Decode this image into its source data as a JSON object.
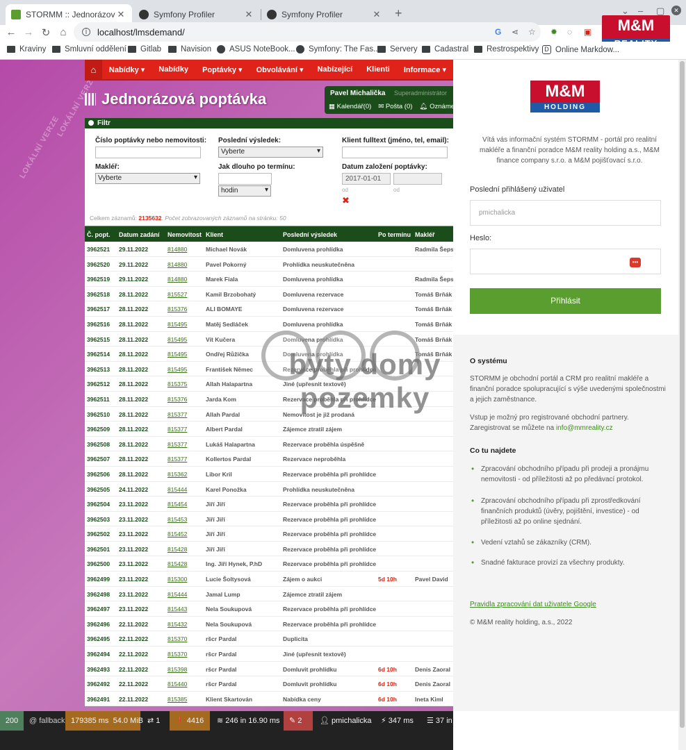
{
  "browser": {
    "tabs": [
      {
        "title": "STORMM :: Jednorázová popt",
        "active": true
      },
      {
        "title": "Symfony Profiler",
        "active": false
      },
      {
        "title": "Symfony Profiler",
        "active": false
      }
    ],
    "url": "localhost/lmsdemand/",
    "bookmarks": [
      "Kraviny",
      "Smluvní oddělení",
      "Gitlab",
      "Navision",
      "ASUS NoteBook...",
      "Symfony: The Fas...",
      "Servery",
      "Cadastral",
      "Restrospektivy",
      "Online Markdow..."
    ],
    "logo_top": "M&M",
    "logo_top_sub": "REALITY"
  },
  "nav": {
    "items": [
      "Nabídky ▾",
      "Nabídky",
      "Poptávky ▾",
      "Obvolávání ▾",
      "Nabízející",
      "Klienti",
      "Informace ▾"
    ]
  },
  "page": {
    "title": "Jednorázová poptávka",
    "watermark_side": "LOKÁLNÍ VERZE",
    "watermark_main": "byty domy pozemky"
  },
  "user": {
    "name": "Pavel Michalička",
    "role": "Superadministrátor",
    "calendar": "Kalendář(0)",
    "mail": "Pošta (0)",
    "notices": "Oznámení"
  },
  "filter": {
    "header": "Filtr",
    "f1_label": "Číslo poptávky nebo nemovitosti:",
    "f2_label": "Poslední výsledek:",
    "f2_value": "Vyberte",
    "f3_label": "Klient fulltext (jméno, tel, email):",
    "f4_label": "Makléř:",
    "f4_value": "Vyberte",
    "f5_label": "Jak dlouho po termínu:",
    "f5_unit": "hodin",
    "f6_label": "Datum založení poptávky:",
    "f6_from": "2017-01-01",
    "od1": "od",
    "od2": "od"
  },
  "counts": {
    "prefix": "Celkem záznamů:",
    "total": "2135632",
    "perpage": "Počet zobrazovaných záznamů na stránku: 50"
  },
  "table": {
    "headers": [
      "Č. popt.",
      "Datum zadání",
      "Nemovitost",
      "Klient",
      "Poslední výsledek",
      "Po termínu",
      "Makléř"
    ],
    "rows": [
      [
        "3962521",
        "29.11.2022",
        "814880",
        "Michael Novák",
        "Domluvena prohlídka",
        "",
        "Radmila Šeps"
      ],
      [
        "3962520",
        "29.11.2022",
        "814880",
        "Pavel Pokorný",
        "Prohlídka neuskutečněna",
        "",
        ""
      ],
      [
        "3962519",
        "29.11.2022",
        "814880",
        "Marek Fiala",
        "Domluvena prohlídka",
        "",
        "Radmila Šeps"
      ],
      [
        "3962518",
        "28.11.2022",
        "815527",
        "Kamil Brzobohatý",
        "Domluvena rezervace",
        "",
        "Tomáš Brňák"
      ],
      [
        "3962517",
        "28.11.2022",
        "815376",
        "ALI BOMAYE",
        "Domluvena rezervace",
        "",
        "Tomáš Brňák"
      ],
      [
        "3962516",
        "28.11.2022",
        "815495",
        "Matěj Sedláček",
        "Domluvena prohlídka",
        "",
        "Tomáš Brňák"
      ],
      [
        "3962515",
        "28.11.2022",
        "815495",
        "Vít Kučera",
        "Domluvena prohlídka",
        "",
        "Tomáš Brňák"
      ],
      [
        "3962514",
        "28.11.2022",
        "815495",
        "Ondřej Růžička",
        "Domluvena prohlídka",
        "",
        "Tomáš Brňák"
      ],
      [
        "3962513",
        "28.11.2022",
        "815495",
        "František Němec",
        "Rezervace proběhla při prohlídce",
        "",
        ""
      ],
      [
        "3962512",
        "28.11.2022",
        "815375",
        "Allah Halapartna",
        "Jiné (upřesnit textově)",
        "",
        ""
      ],
      [
        "3962511",
        "28.11.2022",
        "815376",
        "Jarda Kom",
        "Rezervace proběhla při prohlídce",
        "",
        ""
      ],
      [
        "3962510",
        "28.11.2022",
        "815377",
        "Allah Pardal",
        "Nemovitost je již prodaná",
        "",
        ""
      ],
      [
        "3962509",
        "28.11.2022",
        "815377",
        "Albert Pardal",
        "Zájemce ztratil zájem",
        "",
        ""
      ],
      [
        "3962508",
        "28.11.2022",
        "815377",
        "Lukáš Halapartna",
        "Rezervace proběhla úspěšně",
        "",
        ""
      ],
      [
        "3962507",
        "28.11.2022",
        "815377",
        "Kollertos Pardal",
        "Rezervace neproběhla",
        "",
        ""
      ],
      [
        "3962506",
        "28.11.2022",
        "815362",
        "Libor Kril",
        "Rezervace proběhla při prohlídce",
        "",
        ""
      ],
      [
        "3962505",
        "24.11.2022",
        "815444",
        "Karel Ponožka",
        "Prohlídka neuskutečněna",
        "",
        ""
      ],
      [
        "3962504",
        "23.11.2022",
        "815454",
        "Jiří Jiří",
        "Rezervace proběhla při prohlídce",
        "",
        ""
      ],
      [
        "3962503",
        "23.11.2022",
        "815453",
        "Jiří Jiří",
        "Rezervace proběhla při prohlídce",
        "",
        ""
      ],
      [
        "3962502",
        "23.11.2022",
        "815452",
        "Jiří Jiří",
        "Rezervace proběhla při prohlídce",
        "",
        ""
      ],
      [
        "3962501",
        "23.11.2022",
        "815428",
        "Jiří Jiří",
        "Rezervace proběhla při prohlídce",
        "",
        ""
      ],
      [
        "3962500",
        "23.11.2022",
        "815428",
        "Ing. Jiří Hynek, P.hD",
        "Rezervace proběhla při prohlídce",
        "",
        ""
      ],
      [
        "3962499",
        "23.11.2022",
        "815300",
        "Lucie Šoltysová",
        "Zájem o aukci",
        "5d 10h",
        "Pavel David"
      ],
      [
        "3962498",
        "23.11.2022",
        "815444",
        "Jamal Lump",
        "Zájemce ztratil zájem",
        "",
        ""
      ],
      [
        "3962497",
        "23.11.2022",
        "815443",
        "Nela Soukupová",
        "Rezervace proběhla při prohlídce",
        "",
        ""
      ],
      [
        "3962496",
        "22.11.2022",
        "815432",
        "Nela Soukupová",
        "Rezervace proběhla při prohlídce",
        "",
        ""
      ],
      [
        "3962495",
        "22.11.2022",
        "815370",
        "ršcr Pardal",
        "Duplicita",
        "",
        ""
      ],
      [
        "3962494",
        "22.11.2022",
        "815370",
        "ršcr Pardal",
        "Jiné (upřesnit textově)",
        "",
        ""
      ],
      [
        "3962493",
        "22.11.2022",
        "815398",
        "ršcr Pardal",
        "Domluvit prohlídku",
        "6d 10h",
        "Denis Zaoral"
      ],
      [
        "3962492",
        "22.11.2022",
        "815440",
        "ršcr Pardal",
        "Domluvit prohlídku",
        "6d 10h",
        "Denis Zaoral"
      ],
      [
        "3962491",
        "22.11.2022",
        "815385",
        "Klient Skartován",
        "Nabídka ceny",
        "6d 10h",
        "Ineta Kiml"
      ]
    ]
  },
  "login": {
    "logo_a": "M&M",
    "logo_b": "HOLDING",
    "welcome": "Vítá vás informační systém STORMM - portál pro realitní makléře a finanční poradce M&M reality holding a.s., M&M finance company s.r.o. a M&M pojišťovací s.r.o.",
    "last_user_label": "Poslední přihlášený uživatel",
    "last_user_value": "pmichalicka",
    "password_label": "Heslo:",
    "submit": "Přihlásit"
  },
  "about": {
    "title": "O systému",
    "p1": "STORMM je obchodní portál a CRM pro realitní makléře a finanční poradce spolupracující s výše uvedenými společnostmi a jejich zaměstnance.",
    "p2_text": "Vstup je možný pro registrované obchodní partnery. Zaregistrovat se můžete na ",
    "p2_link": "info@mmreality.cz",
    "co_title": "Co tu najdete",
    "items": [
      "Zpracování obchodního případu při prodeji a pronájmu nemovitosti - od příležitosti až po předávací protokol.",
      "Zpracování obchodního případu při zprostředkování finančních produktů (úvěry, pojištění, investice) - od příležitosti až po online sjednání.",
      "Vedení vztahů se zákazníky (CRM).",
      "Snadné fakturace provizí za všechny produkty."
    ],
    "google_link": "Pravidla zpracování dat uživatele Google",
    "copyright": "© M&M reality holding, a.s., 2022"
  },
  "profiler": {
    "status": "200",
    "route": "@ fallback",
    "time": "179385 ms",
    "memory": "54.0 MiB",
    "requests": "1",
    "logs": "4416",
    "cache": "246 in 16.90 ms",
    "translations": "2",
    "user": "pmichalicka",
    "events": "347 ms",
    "db": "37 in"
  },
  "colors": {
    "nav_red": "#e0231a",
    "dark_green": "#1a4d1a",
    "login_green": "#5a9e2f",
    "page_purple": "#b54aa8"
  }
}
